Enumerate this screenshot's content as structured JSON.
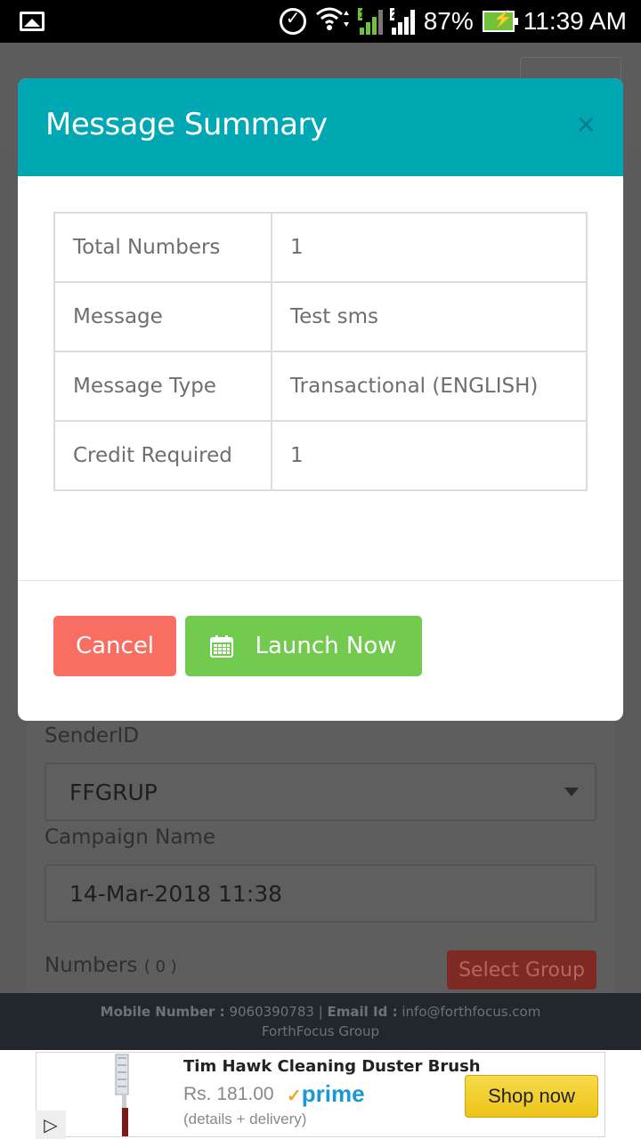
{
  "status_bar": {
    "battery": "87%",
    "time": "11:39 AM",
    "sim1_badge": "1",
    "sim2_badge": "2",
    "icons": [
      "gallery-icon",
      "alarm-icon",
      "wifi-icon",
      "signal-sim1-icon",
      "signal-sim2-icon",
      "battery-charging-icon"
    ]
  },
  "modal": {
    "title": "Message Summary",
    "close_icon": "close-icon",
    "rows": [
      {
        "label": "Total Numbers",
        "value": "1"
      },
      {
        "label": "Message",
        "value": "Test sms"
      },
      {
        "label": "Message Type",
        "value": "Transactional (ENGLISH)"
      },
      {
        "label": "Credit Required",
        "value": "1"
      }
    ],
    "cancel_label": "Cancel",
    "launch_label": "Launch Now",
    "launch_icon": "calendar-icon",
    "colors": {
      "header": "#00a8b3",
      "cancel": "#f96e62",
      "launch": "#72cb4f"
    }
  },
  "form": {
    "sender_label": "SenderID",
    "sender_value": "FFGRUP",
    "campaign_label": "Campaign Name",
    "campaign_value": "14-Mar-2018 11:38",
    "numbers_label": "Numbers",
    "numbers_count": "( 0 )",
    "select_group_label": "Select Group"
  },
  "footer": {
    "mobile_label": "Mobile Number :",
    "mobile_value": "9060390783",
    "separator": "|",
    "email_label": "Email Id :",
    "email_value": "info@forthfocus.com",
    "company": "ForthFocus Group"
  },
  "ad": {
    "title": "Tim Hawk Cleaning Duster Brush",
    "price": "Rs. 181.00",
    "prime_check": "✓",
    "prime": "prime",
    "details": "(details + delivery)",
    "cta": "Shop now"
  }
}
